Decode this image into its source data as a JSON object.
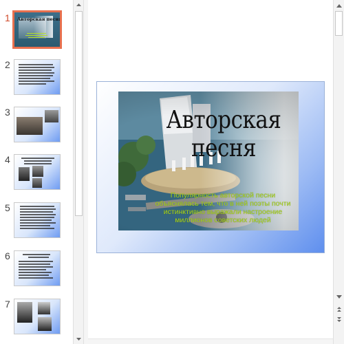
{
  "thumbnails": [
    {
      "number": "1",
      "title": "Авторская песня"
    },
    {
      "number": "2"
    },
    {
      "number": "3"
    },
    {
      "number": "4"
    },
    {
      "number": "5"
    },
    {
      "number": "6"
    },
    {
      "number": "7"
    }
  ],
  "active_slide": 1,
  "slide": {
    "title": "Авторская песня",
    "body": "Популярность авторской песни объяснялась тем, что в ней поэты почти истинктивно выражали настроение миллионов советских людей"
  },
  "colors": {
    "accent": "#e8704e",
    "body_text": "#a8d21e",
    "slide_gradient_end": "#5f8fee"
  },
  "icons": [
    "scroll-up-icon",
    "scroll-down-icon",
    "previous-slide-icon",
    "next-slide-icon"
  ]
}
